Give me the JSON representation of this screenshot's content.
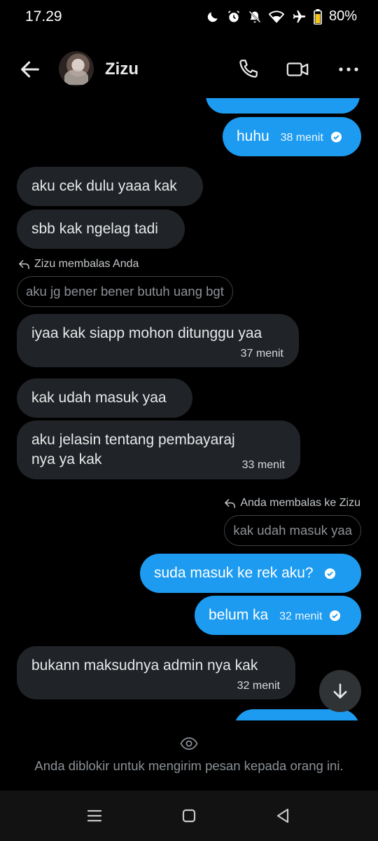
{
  "status_bar": {
    "time": "17.29",
    "battery": "80%",
    "icons": [
      "moon-icon",
      "alarm-icon",
      "bell-off-icon",
      "wifi-icon",
      "airplane-icon",
      "battery-icon"
    ]
  },
  "header": {
    "contact_name": "Zizu",
    "icons": [
      "back-arrow-icon",
      "phone-icon",
      "video-icon",
      "more-icon"
    ]
  },
  "messages": [
    {
      "direction": "out",
      "text": "huhu",
      "time": "38 menit",
      "status": "read"
    },
    {
      "direction": "in",
      "text": "aku cek dulu yaaa kak"
    },
    {
      "direction": "in",
      "text": "sbb kak ngelag tadi"
    },
    {
      "direction": "in",
      "reply_label": "Zizu membalas Anda",
      "reply_quote": "aku jg bener bener butuh uang bgt",
      "text": "iyaa kak siapp mohon ditunggu yaa",
      "time": "37 menit"
    },
    {
      "direction": "in",
      "text": "kak udah masuk yaa"
    },
    {
      "direction": "in",
      "text_line1": "aku jelasin tentang pembayaraj",
      "text_line2": "nya ya kak",
      "time": "33 menit"
    },
    {
      "direction": "out",
      "reply_label": "Anda membalas ke Zizu",
      "reply_quote": "kak udah masuk yaa",
      "text": "suda masuk ke rek aku?",
      "status": "read"
    },
    {
      "direction": "out",
      "text": "belum ka",
      "time": "32 menit",
      "status": "read"
    },
    {
      "direction": "in",
      "text": "bukann maksudnya admin nya kak",
      "time": "32 menit"
    }
  ],
  "footer": {
    "blocked_text": "Anda diblokir untuk mengirim pesan kepada orang ini."
  },
  "colors": {
    "outgoing_bubble": "#1d9bf0",
    "incoming_bubble": "#202327",
    "background": "#000000"
  }
}
